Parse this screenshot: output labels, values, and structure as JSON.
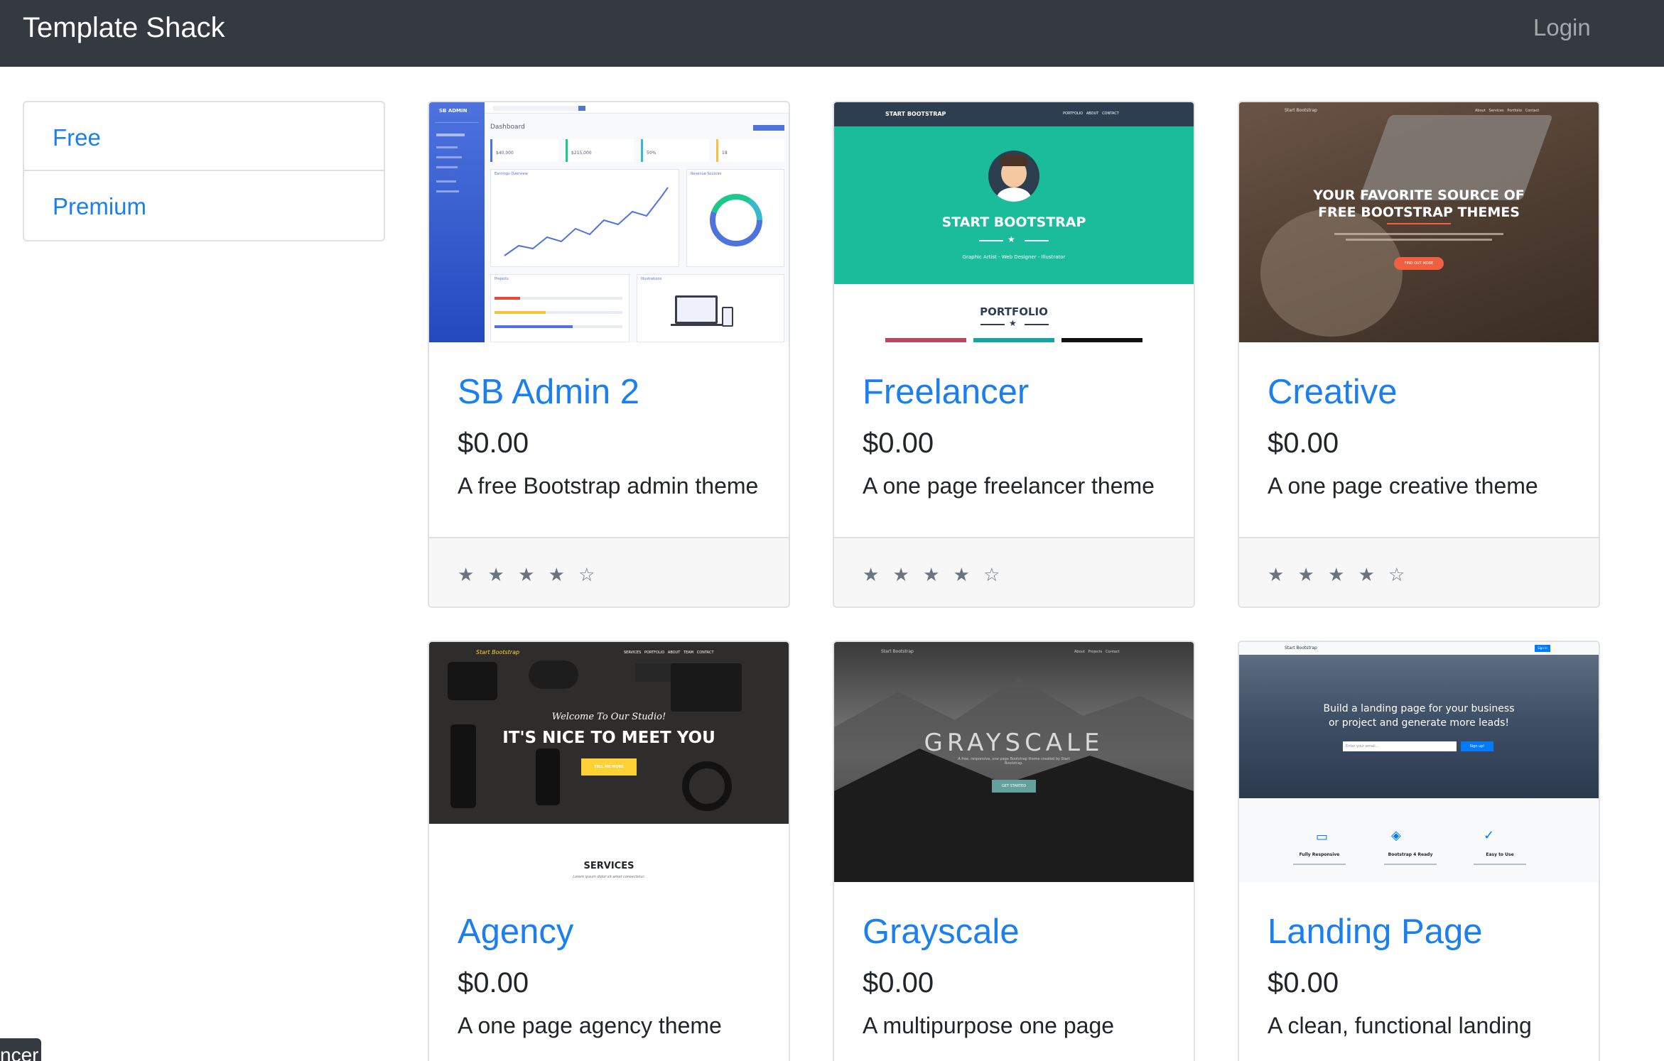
{
  "navbar": {
    "brand": "Template Shack",
    "login": "Login"
  },
  "sidebar": {
    "items": [
      {
        "label": "Free"
      },
      {
        "label": "Premium"
      }
    ]
  },
  "cards": [
    {
      "title": "SB Admin 2",
      "price": "$0.00",
      "description": "A free Bootstrap admin theme",
      "rating": 4,
      "stars": "★ ★ ★ ★ ☆"
    },
    {
      "title": "Freelancer",
      "price": "$0.00",
      "description": "A one page freelancer theme",
      "rating": 4,
      "stars": "★ ★ ★ ★ ☆"
    },
    {
      "title": "Creative",
      "price": "$0.00",
      "description": "A one page creative theme",
      "rating": 4,
      "stars": "★ ★ ★ ★ ☆"
    },
    {
      "title": "Agency",
      "price": "$0.00",
      "description": "A one page agency theme"
    },
    {
      "title": "Grayscale",
      "price": "$0.00",
      "description": "A multipurpose one page"
    },
    {
      "title": "Landing Page",
      "price": "$0.00",
      "description": "A clean, functional landing"
    }
  ],
  "thumbs": {
    "sbadmin": {
      "brand": "SB ADMIN",
      "heading": "Dashboard",
      "earnings": "Earnings Overview",
      "revenue": "Revenue Sources",
      "projects": "Projects",
      "illustrations": "Illustrations",
      "stat1": "$40,000",
      "stat2": "$215,000",
      "stat3": "50%",
      "stat4": "18"
    },
    "freelancer": {
      "nav": "START BOOTSTRAP",
      "links": "PORTFOLIO   ABOUT   CONTACT",
      "title": "START BOOTSTRAP",
      "subtitle": "Graphic Artist - Web Designer - Illustrator",
      "section": "PORTFOLIO"
    },
    "creative": {
      "nav": "Start Bootstrap",
      "links": "About   Services   Portfolio   Contact",
      "line1": "YOUR FAVORITE SOURCE OF",
      "line2": "FREE BOOTSTRAP THEMES",
      "button": "FIND OUT MORE"
    },
    "agency": {
      "nav": "Start Bootstrap",
      "links": "SERVICES   PORTFOLIO   ABOUT   TEAM   CONTACT",
      "welcome": "Welcome To Our Studio!",
      "headline": "IT'S NICE TO MEET YOU",
      "button": "TELL ME MORE",
      "section": "SERVICES",
      "sub": "Lorem ipsum dolor sit amet consectetur."
    },
    "grayscale": {
      "nav": "Start Bootstrap",
      "links": "About   Projects   Contact",
      "title": "GRAYSCALE",
      "sub": "A free, responsive, one page Bootstrap theme created by Start Bootstrap.",
      "button": "GET STARTED"
    },
    "landing": {
      "nav": "Start Bootstrap",
      "signin": "Sign In",
      "line1": "Build a landing page for your business",
      "line2": "or project and generate more leads!",
      "placeholder": "Enter your email...",
      "signup": "Sign up!",
      "f1": "Fully Responsive",
      "f2": "Bootstrap 4 Ready",
      "f3": "Easy to Use"
    }
  },
  "toast": {
    "text": "ncer"
  },
  "colors": {
    "navbar": "#343a40",
    "link": "#1b7ff0",
    "freelancer_teal": "#1abc9c",
    "sbadmin_blue": "#4e73df"
  }
}
